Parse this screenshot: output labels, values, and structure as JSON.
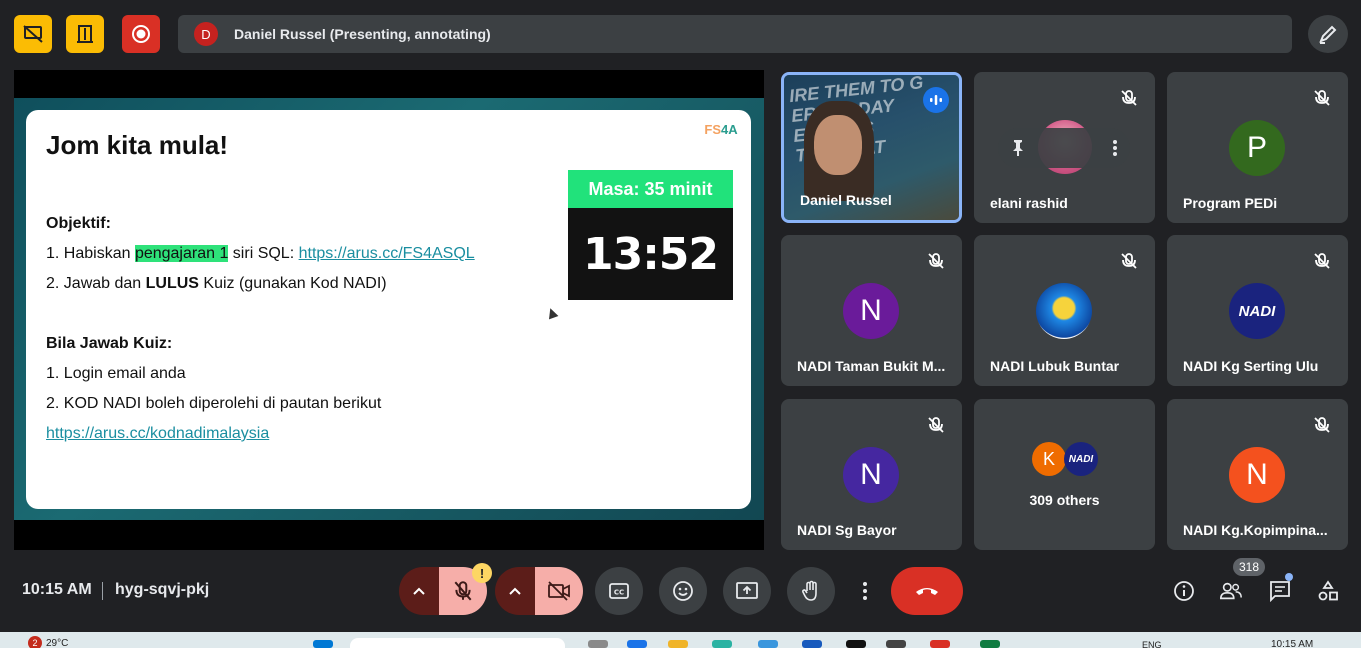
{
  "top_bar": {
    "presenter_initial": "D",
    "presenter_status": "Daniel Russel (Presenting, annotating)"
  },
  "slide": {
    "title": "Jom kita mula!",
    "logo_text_a": "FS",
    "logo_text_b": "4A",
    "objective_heading": "Objektif:",
    "obj1_prefix": "1. Habiskan ",
    "obj1_highlight": "pengajaran 1",
    "obj1_mid": " siri SQL: ",
    "obj1_link": "https://arus.cc/FS4ASQL",
    "obj2_prefix": "2. Jawab dan ",
    "obj2_bold": "LULUS",
    "obj2_suffix": " Kuiz (gunakan Kod NADI)",
    "quiz_heading": "Bila Jawab Kuiz:",
    "quiz1": "1. Login email anda",
    "quiz2": "2. KOD NADI boleh diperolehi di pautan berikut",
    "quiz_link": "https://arus.cc/kodnadimalaysia",
    "timer_label": "Masa: 35 minit",
    "timer_value": "13:52"
  },
  "participants": {
    "t1": {
      "name": "Daniel Russel",
      "cam_text": "IRE THEM TO G\nERS TODAY\nE SKILLS\nTO CREAT"
    },
    "t2": {
      "name": "elani rashid"
    },
    "t3": {
      "name": "Program PEDi",
      "initial": "P"
    },
    "t4": {
      "name": "NADI Taman Bukit M...",
      "initial": "N"
    },
    "t5": {
      "name": "NADI Lubuk Buntar"
    },
    "t6": {
      "name": "NADI Kg Serting Ulu",
      "logo": "NADI"
    },
    "t7": {
      "name": "NADI Sg Bayor",
      "initial": "N"
    },
    "t8": {
      "others_label": "309 others",
      "initial": "K",
      "logo": "NADI"
    },
    "t9": {
      "name": "NADI Kg.Kopimpina...",
      "initial": "N"
    }
  },
  "bottom_bar": {
    "time": "10:15 AM",
    "meeting_code": "hyg-sqvj-pkj",
    "warn_badge": "!",
    "participant_count": "318"
  },
  "taskbar": {
    "weather_badge": "2",
    "temperature": "29°C",
    "lang": "ENG",
    "clock": "10:15 AM"
  },
  "colors": {
    "accent_yellow": "#fbbc04",
    "record_red": "#d93025",
    "timer_green": "#21e27b",
    "speaking_border": "#8ab4f8"
  }
}
